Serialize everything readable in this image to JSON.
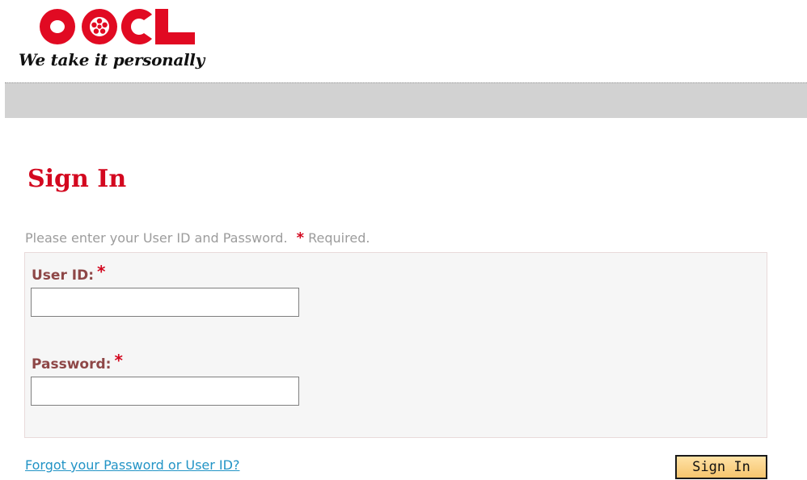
{
  "brand": {
    "logo_text": "OOCL",
    "tagline": "We take it personally",
    "color": "#e10a22"
  },
  "heading": "Sign In",
  "instruction": {
    "text": "Please enter your User ID and Password.",
    "required_star": "*",
    "required_text": "Required."
  },
  "form": {
    "user_id_label": "User ID:",
    "password_label": "Password:",
    "required_star": "*",
    "user_id_value": "",
    "password_value": ""
  },
  "forgot_link": "Forgot your Password or User ID?",
  "sign_in_button": "Sign In"
}
